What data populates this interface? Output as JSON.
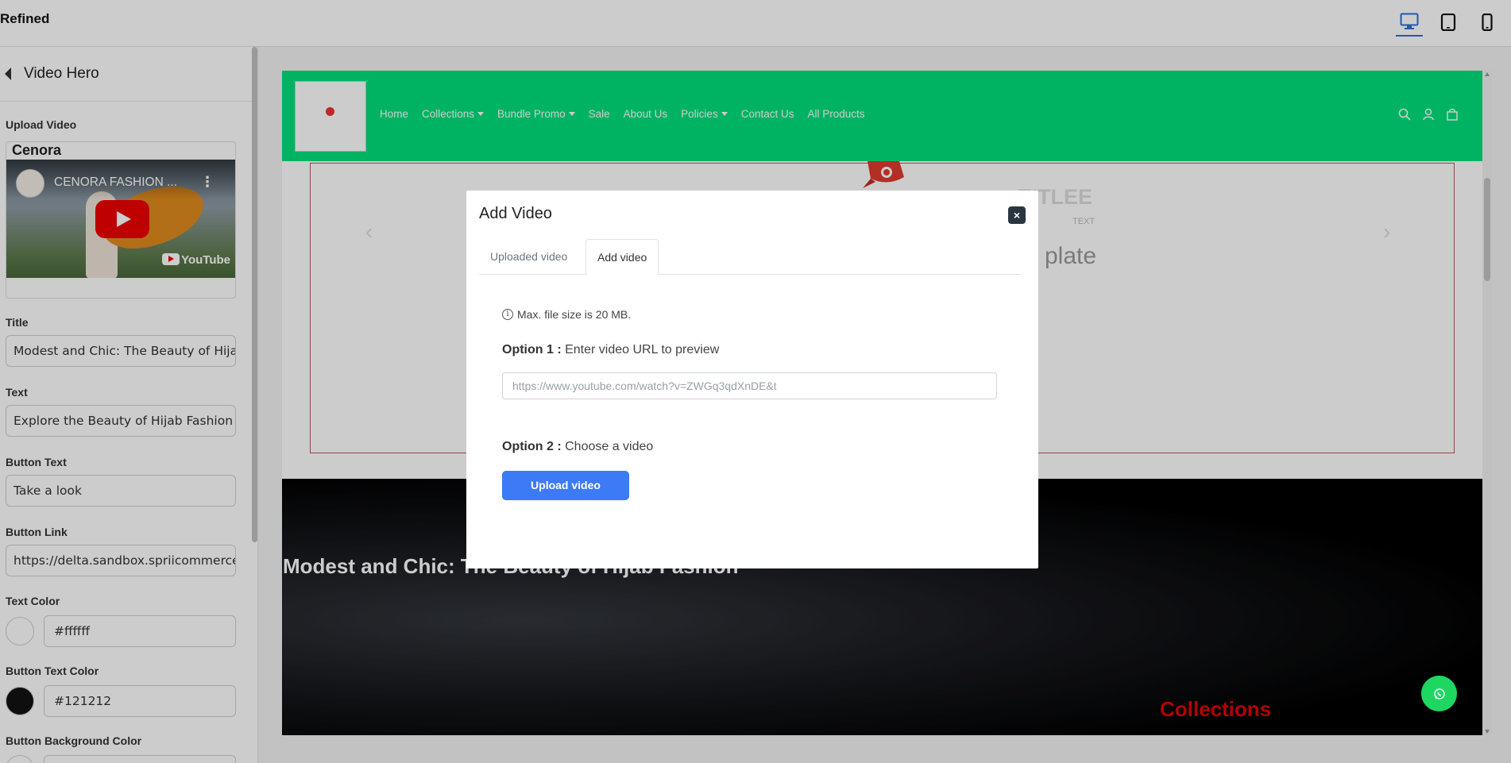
{
  "app": {
    "title": "Refined"
  },
  "devices": [
    {
      "name": "desktop",
      "active": true
    },
    {
      "name": "tablet",
      "active": false
    },
    {
      "name": "mobile",
      "active": false
    }
  ],
  "panel": {
    "back_title": "Video Hero",
    "upload_label": "Upload Video",
    "video_preview": {
      "channel_title": "CENORA FASHION ...",
      "logo_text": "YouTube",
      "behind_text": "Cenora"
    },
    "title_label": "Title",
    "title_value": "Modest and Chic: The Beauty of Hijab Fashion",
    "text_label": "Text",
    "text_value": "Explore the Beauty of Hijab Fashion with Cenora",
    "button_text_label": "Button Text",
    "button_text_value": "Take a look",
    "button_link_label": "Button Link",
    "button_link_value": "https://delta.sandbox.spriicommerce.com",
    "text_color_label": "Text Color",
    "text_color_value": "#ffffff",
    "button_text_color_label": "Button Text Color",
    "button_text_color_value": "#121212",
    "button_bg_color_label": "Button Background Color"
  },
  "store": {
    "nav": [
      "Home",
      "Collections",
      "Bundle Promo",
      "Sale",
      "About Us",
      "Policies",
      "Contact Us",
      "All Products"
    ],
    "nav_dropdowns": [
      false,
      true,
      true,
      false,
      false,
      true,
      false,
      false
    ],
    "hero_title": "TITLEE",
    "hero_text": "TEXT",
    "hero_partial": "plate",
    "video_title": "Modest and Chic: The Beauty of Hijab Fashion",
    "collections_label": "Collections",
    "header_color": "#00e07c"
  },
  "modal": {
    "title": "Add Video",
    "close_symbol": "×",
    "tabs": [
      "Uploaded video",
      "Add video"
    ],
    "active_tab": "Add video",
    "info": "Max. file size is 20 MB.",
    "option1_label": "Option 1 :",
    "option1_text": "Enter video URL to preview",
    "url_placeholder": "https://www.youtube.com/watch?v=ZWGq3qdXnDE&t",
    "option2_label": "Option 2 :",
    "option2_text": "Choose a video",
    "upload_button": "Upload video"
  }
}
